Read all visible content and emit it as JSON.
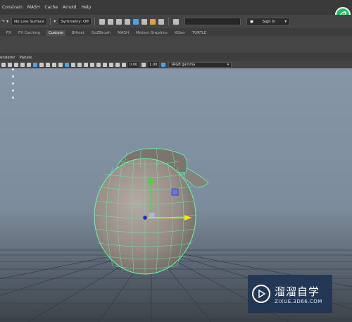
{
  "menubar": {
    "items": [
      "Constrain",
      "MASH",
      "Cache",
      "Arnold",
      "Help"
    ]
  },
  "statusline": {
    "live_surface": "No Live Surface",
    "symmetry": "Symmetry: Off",
    "sign_in": "Sign In",
    "sign_in_chevron": "▾"
  },
  "shelf": {
    "tabs": [
      "FX",
      "FX Caching",
      "Custom",
      "Bifrost",
      "GoZBrush",
      "MASH",
      "Motion Graphics",
      "XGen",
      "TURTLE"
    ],
    "active_tab": "Custom"
  },
  "panel_menu": {
    "items": [
      "enderer",
      "Panels"
    ]
  },
  "panel_toolbar": {
    "exposure": "0.00",
    "gamma": "1.00",
    "colorspace": "sRGB gamma",
    "colorspace_chevron": "▾"
  },
  "watermark": {
    "main": "溜溜自学",
    "sub": "ZIXUE.3D66.COM"
  },
  "colors": {
    "wireframe": "#5dffa6",
    "axis_x": "#ffea00",
    "axis_y": "#32e61f",
    "pivot": "#1a28d8",
    "brand": "#17c25a"
  },
  "icons": {
    "logo": "leaf-logo-icon",
    "sign_in": "user-icon",
    "watermark": "play-icon"
  }
}
